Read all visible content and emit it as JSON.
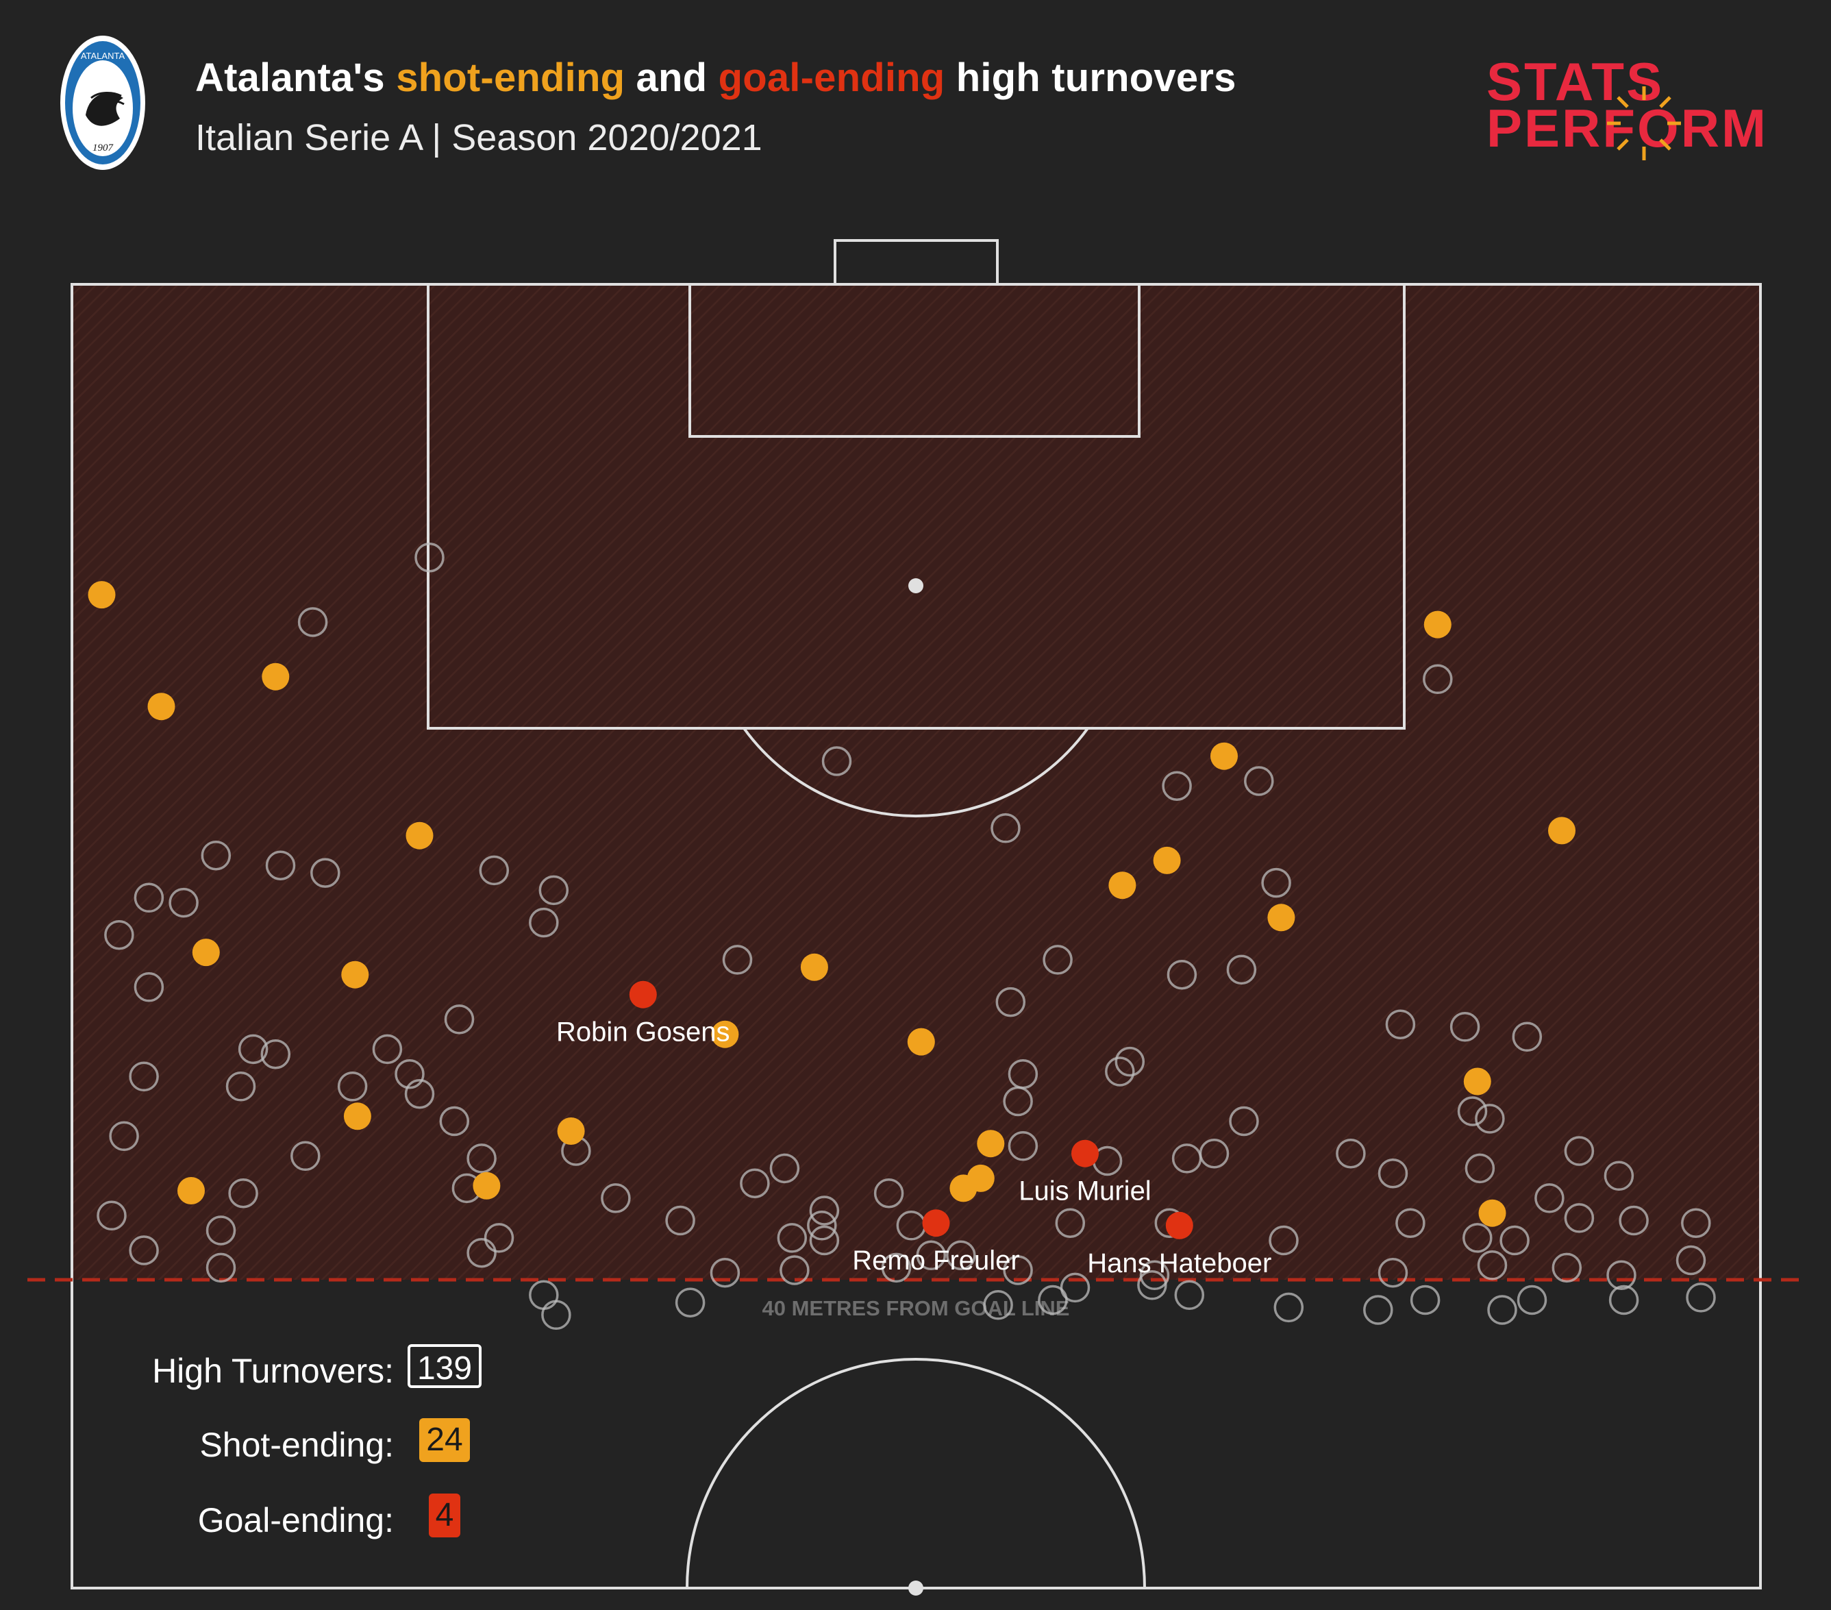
{
  "header": {
    "title_parts": [
      "Atalanta's ",
      "shot-ending",
      " and ",
      "goal-ending",
      " high turnovers"
    ],
    "subtitle": "Italian Serie A | Season 2020/2021",
    "brand_line1": "STATS",
    "brand_line2": "PERFORM",
    "crest_text_top": "ATALANTA",
    "crest_year": "1907"
  },
  "colors": {
    "background": "#232323",
    "zone_fill": "#3a1e1b",
    "shot_ending": "#f0a21e",
    "goal_ending": "#e03212",
    "neutral": "#bdbdbd",
    "line": "#e0e0e0",
    "threshold": "#b52a1a"
  },
  "pitch": {
    "threshold_label": "40 METRES FROM GOAL LINE"
  },
  "legend": {
    "items": [
      {
        "label": "High Turnovers:",
        "value": "139"
      },
      {
        "label": "Shot-ending:",
        "value": "24"
      },
      {
        "label": "Goal-ending:",
        "value": "4"
      }
    ]
  },
  "chart_data": {
    "type": "scatter",
    "title": "Atalanta's shot-ending and goal-ending high turnovers",
    "subtitle": "Italian Serie A | Season 2020/2021",
    "units": "metres (x across pitch width 0–68, y distance from goal line)",
    "xlim": [
      0,
      68
    ],
    "ylim": [
      0,
      52.5
    ],
    "grid": false,
    "series": [
      {
        "name": "Goal-ending",
        "points": [
          {
            "x": 23.0,
            "y": 28.6,
            "label": "Robin Gosens"
          },
          {
            "x": 34.8,
            "y": 37.8,
            "label": "Remo Freuler"
          },
          {
            "x": 40.8,
            "y": 35.0,
            "label": "Luis Muriel"
          },
          {
            "x": 44.6,
            "y": 37.9,
            "label": "Hans Hateboer"
          }
        ]
      },
      {
        "name": "Shot-ending",
        "points": [
          {
            "x": 55.0,
            "y": 13.7
          },
          {
            "x": 46.4,
            "y": 19.0
          },
          {
            "x": 14.0,
            "y": 22.2
          },
          {
            "x": 44.1,
            "y": 23.2
          },
          {
            "x": 42.3,
            "y": 24.2
          },
          {
            "x": 48.7,
            "y": 25.5
          },
          {
            "x": 5.4,
            "y": 26.9
          },
          {
            "x": 11.4,
            "y": 27.8
          },
          {
            "x": 29.9,
            "y": 27.5
          },
          {
            "x": 26.3,
            "y": 30.2
          },
          {
            "x": 34.2,
            "y": 30.5
          },
          {
            "x": 56.6,
            "y": 32.1
          },
          {
            "x": 11.5,
            "y": 33.5
          },
          {
            "x": 20.1,
            "y": 34.1
          },
          {
            "x": 37.0,
            "y": 34.6
          },
          {
            "x": 4.8,
            "y": 36.5
          },
          {
            "x": 16.7,
            "y": 36.3
          },
          {
            "x": 36.6,
            "y": 36.0
          },
          {
            "x": 35.9,
            "y": 36.4
          },
          {
            "x": 57.2,
            "y": 37.4
          },
          {
            "x": 1.2,
            "y": 12.5
          },
          {
            "x": 3.6,
            "y": 17.0
          },
          {
            "x": 8.2,
            "y": 15.8
          },
          {
            "x": 60.0,
            "y": 22.0
          }
        ]
      },
      {
        "name": "Other high turnovers",
        "points": [
          {
            "x": 14.4,
            "y": 11.0
          },
          {
            "x": 9.7,
            "y": 13.6
          },
          {
            "x": 55.0,
            "y": 15.9
          },
          {
            "x": 30.8,
            "y": 19.2
          },
          {
            "x": 44.5,
            "y": 20.2
          },
          {
            "x": 47.8,
            "y": 20.0
          },
          {
            "x": 37.6,
            "y": 21.9
          },
          {
            "x": 5.8,
            "y": 23.0
          },
          {
            "x": 10.2,
            "y": 23.7
          },
          {
            "x": 17.0,
            "y": 23.6
          },
          {
            "x": 19.4,
            "y": 24.4
          },
          {
            "x": 3.1,
            "y": 24.7
          },
          {
            "x": 4.5,
            "y": 24.9
          },
          {
            "x": 48.5,
            "y": 24.1
          },
          {
            "x": 19.0,
            "y": 25.7
          },
          {
            "x": 1.9,
            "y": 26.2
          },
          {
            "x": 26.8,
            "y": 27.2
          },
          {
            "x": 39.7,
            "y": 27.2
          },
          {
            "x": 44.7,
            "y": 27.8
          },
          {
            "x": 47.1,
            "y": 27.6
          },
          {
            "x": 3.1,
            "y": 28.3
          },
          {
            "x": 37.8,
            "y": 28.9
          },
          {
            "x": 15.6,
            "y": 29.6
          },
          {
            "x": 53.5,
            "y": 29.8
          },
          {
            "x": 56.1,
            "y": 29.9
          },
          {
            "x": 58.6,
            "y": 30.3
          },
          {
            "x": 7.3,
            "y": 30.8
          },
          {
            "x": 12.7,
            "y": 30.8
          },
          {
            "x": 13.6,
            "y": 31.8
          },
          {
            "x": 38.3,
            "y": 31.8
          },
          {
            "x": 42.6,
            "y": 31.3
          },
          {
            "x": 42.2,
            "y": 31.7
          },
          {
            "x": 2.9,
            "y": 31.9
          },
          {
            "x": 6.8,
            "y": 32.3
          },
          {
            "x": 11.3,
            "y": 32.3
          },
          {
            "x": 14.0,
            "y": 32.6
          },
          {
            "x": 38.1,
            "y": 32.9
          },
          {
            "x": 56.4,
            "y": 33.3
          },
          {
            "x": 15.4,
            "y": 33.7
          },
          {
            "x": 47.2,
            "y": 33.7
          },
          {
            "x": 57.1,
            "y": 33.6
          },
          {
            "x": 2.1,
            "y": 34.3
          },
          {
            "x": 20.3,
            "y": 34.9
          },
          {
            "x": 38.3,
            "y": 34.7
          },
          {
            "x": 46.0,
            "y": 35.0
          },
          {
            "x": 51.5,
            "y": 35.0
          },
          {
            "x": 60.7,
            "y": 34.9
          },
          {
            "x": 16.5,
            "y": 35.2
          },
          {
            "x": 28.7,
            "y": 35.6
          },
          {
            "x": 41.7,
            "y": 35.3
          },
          {
            "x": 53.2,
            "y": 35.8
          },
          {
            "x": 62.3,
            "y": 35.9
          },
          {
            "x": 6.9,
            "y": 36.6
          },
          {
            "x": 59.5,
            "y": 36.8
          },
          {
            "x": 1.6,
            "y": 37.5
          },
          {
            "x": 24.5,
            "y": 37.7
          },
          {
            "x": 30.3,
            "y": 37.3
          },
          {
            "x": 30.2,
            "y": 37.9
          },
          {
            "x": 33.8,
            "y": 37.9
          },
          {
            "x": 40.2,
            "y": 37.8
          },
          {
            "x": 44.2,
            "y": 37.8
          },
          {
            "x": 53.9,
            "y": 37.8
          },
          {
            "x": 60.7,
            "y": 37.6
          },
          {
            "x": 62.9,
            "y": 37.7
          },
          {
            "x": 65.4,
            "y": 37.8
          },
          {
            "x": 6.0,
            "y": 38.1
          },
          {
            "x": 17.2,
            "y": 38.4
          },
          {
            "x": 29.0,
            "y": 38.4
          },
          {
            "x": 30.3,
            "y": 38.5
          },
          {
            "x": 48.8,
            "y": 38.5
          },
          {
            "x": 56.6,
            "y": 38.4
          },
          {
            "x": 58.1,
            "y": 38.5
          },
          {
            "x": 2.9,
            "y": 38.9
          },
          {
            "x": 16.5,
            "y": 39.0
          },
          {
            "x": 35.8,
            "y": 39.1
          },
          {
            "x": 26.3,
            "y": 39.8
          },
          {
            "x": 29.1,
            "y": 39.7
          },
          {
            "x": 33.2,
            "y": 39.6
          },
          {
            "x": 38.1,
            "y": 39.7
          },
          {
            "x": 43.6,
            "y": 39.9
          },
          {
            "x": 53.2,
            "y": 39.8
          },
          {
            "x": 57.2,
            "y": 39.5
          },
          {
            "x": 62.4,
            "y": 39.9
          },
          {
            "x": 65.2,
            "y": 39.3
          },
          {
            "x": 6.0,
            "y": 39.6
          },
          {
            "x": 19.0,
            "y": 40.7
          },
          {
            "x": 43.5,
            "y": 40.3
          },
          {
            "x": 58.8,
            "y": 40.9
          },
          {
            "x": 24.9,
            "y": 41.0
          },
          {
            "x": 37.3,
            "y": 41.1
          },
          {
            "x": 39.5,
            "y": 40.9
          },
          {
            "x": 54.5,
            "y": 40.9
          },
          {
            "x": 62.5,
            "y": 40.9
          },
          {
            "x": 65.6,
            "y": 40.8
          },
          {
            "x": 19.5,
            "y": 41.5
          },
          {
            "x": 45.0,
            "y": 40.7
          },
          {
            "x": 40.4,
            "y": 40.4
          },
          {
            "x": 49.0,
            "y": 41.2
          },
          {
            "x": 52.6,
            "y": 41.3
          },
          {
            "x": 57.6,
            "y": 41.3
          },
          {
            "x": 8.4,
            "y": 23.4
          },
          {
            "x": 21.9,
            "y": 36.8
          },
          {
            "x": 32.9,
            "y": 36.6
          },
          {
            "x": 44.9,
            "y": 35.2
          },
          {
            "x": 27.5,
            "y": 36.2
          },
          {
            "x": 8.2,
            "y": 31.0
          },
          {
            "x": 15.9,
            "y": 36.4
          },
          {
            "x": 60.2,
            "y": 39.6
          },
          {
            "x": 56.7,
            "y": 35.6
          },
          {
            "x": 9.4,
            "y": 35.1
          },
          {
            "x": 34.6,
            "y": 39.1
          }
        ]
      }
    ]
  }
}
